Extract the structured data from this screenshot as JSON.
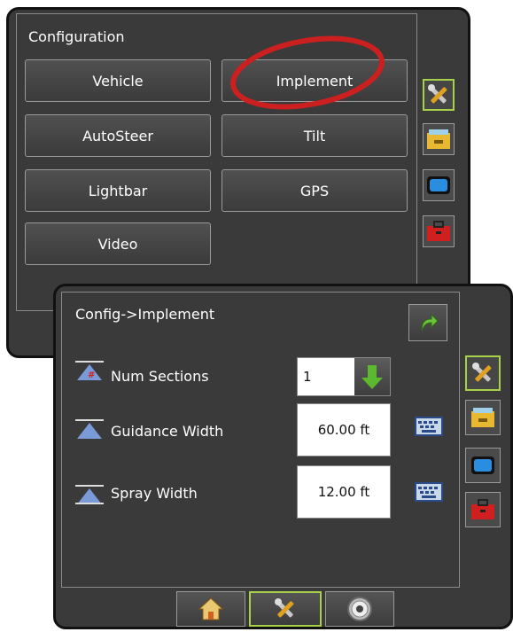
{
  "config": {
    "title": "Configuration",
    "buttons": [
      "Vehicle",
      "Implement",
      "AutoSteer",
      "Tilt",
      "Lightbar",
      "GPS",
      "Video"
    ],
    "highlight_color": "#cc1f1f"
  },
  "implement": {
    "title": "Config->Implement",
    "num_sections_label": "Num Sections",
    "num_sections_value": "1",
    "guidance_width_label": "Guidance Width",
    "guidance_width_value": "60.00 ft",
    "spray_width_label": "Spray Width",
    "spray_width_value": "12.00 ft"
  },
  "side_tabs": [
    "tools-icon",
    "folder-icon",
    "screen-icon",
    "toolbox-icon"
  ],
  "bottom_nav": [
    "home-icon",
    "tools-icon",
    "gauge-icon"
  ],
  "colors": {
    "accent": "#a8d14a",
    "arrow": "#5cb82e"
  }
}
